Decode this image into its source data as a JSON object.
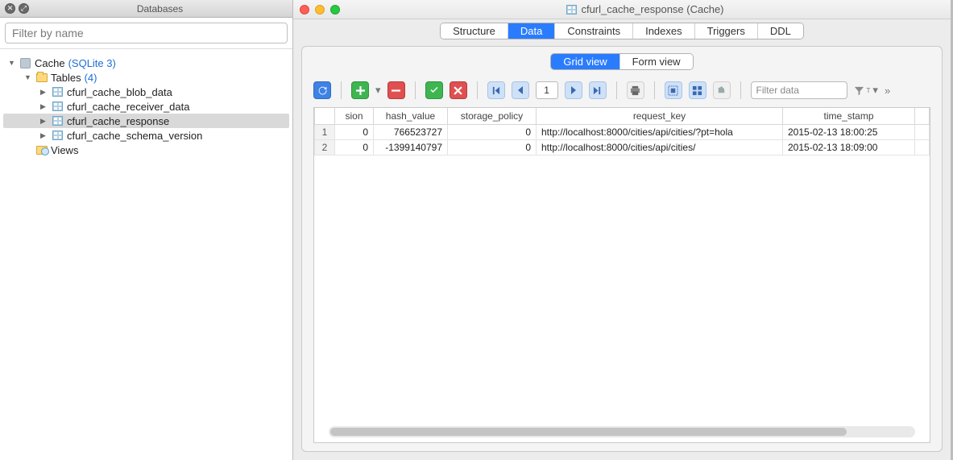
{
  "sidebar": {
    "title": "Databases",
    "filter_placeholder": "Filter by name",
    "root": {
      "label": "Cache",
      "engine": "(SQLite 3)"
    },
    "tables_label": "Tables",
    "tables_count": "(4)",
    "tables": [
      "cfurl_cache_blob_data",
      "cfurl_cache_receiver_data",
      "cfurl_cache_response",
      "cfurl_cache_schema_version"
    ],
    "selected_table_index": 2,
    "views_label": "Views"
  },
  "window": {
    "title": "cfurl_cache_response (Cache)",
    "tabs": [
      "Structure",
      "Data",
      "Constraints",
      "Indexes",
      "Triggers",
      "DDL"
    ],
    "active_tab": "Data",
    "view_modes": [
      "Grid view",
      "Form view"
    ],
    "active_mode": "Grid view"
  },
  "toolbar": {
    "page": "1",
    "filter_placeholder": "Filter data"
  },
  "grid": {
    "columns": [
      "sion",
      "hash_value",
      "storage_policy",
      "request_key",
      "time_stamp"
    ],
    "rows": [
      {
        "num": "1",
        "sion": "0",
        "hash_value": "766523727",
        "storage_policy": "0",
        "request_key": "http://localhost:8000/cities/api/cities/?pt=hola",
        "time_stamp": "2015-02-13 18:00:25"
      },
      {
        "num": "2",
        "sion": "0",
        "hash_value": "-1399140797",
        "storage_policy": "0",
        "request_key": "http://localhost:8000/cities/api/cities/",
        "time_stamp": "2015-02-13 18:09:00"
      }
    ]
  }
}
